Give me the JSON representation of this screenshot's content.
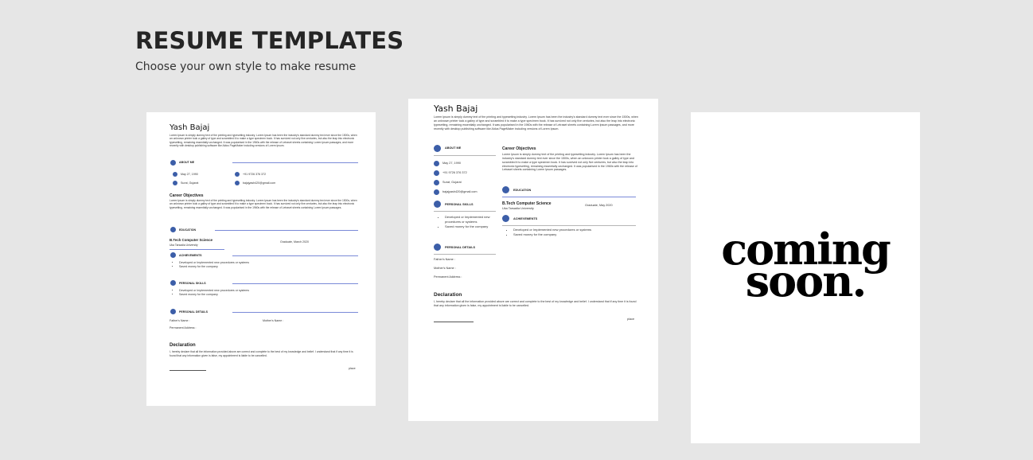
{
  "header": {
    "title": "RESUME TEMPLATES",
    "subtitle": "Choose your own style to make resume"
  },
  "resume": {
    "name": "Yash Bajaj",
    "summary": "Lorem Ipsum is simply dummy text of the printing and typesetting industry. Lorem Ipsum has been the industry's standard dummy text ever since the 1500s, when an unknown printer took a galley of type and scrambled it to make a type specimen book. It has survived not only five centuries, but also the leap into electronic typesetting, remaining essentially unchanged. It was popularised in the 1960s with the release of Letraset sheets containing Lorem Ipsum passages, and more recently with desktop publishing software like Aldus PageMaker including versions of Lorem Ipsum.",
    "about_heading": "ABOUT ME",
    "dob": "May 27, 1990",
    "phone": "+91 9726 376 372",
    "location": "Surat, Gujarat",
    "email": "bajajyash420@gmail.com",
    "objective_heading": "Career Objectives",
    "objective": "Lorem Ipsum is simply dummy text of the printing and typesetting industry. Lorem Ipsum has been the industry's standard dummy text ever since the 1500s, when an unknown printer took a galley of type and scrambled it to make a type specimen book. It has survived not only five centuries, but also the leap into electronic typesetting, remaining essentially unchanged. It was popularised in the 1960s with the release of Letraset sheets containing Lorem Ipsum passages.",
    "education_heading": "EDUCATION",
    "degree": "B.Tech Computer Science",
    "university": "Uka Tarsadia University",
    "graduation": "Graduate, March 2020",
    "graduation_alt": "Graduate, May 2020",
    "achievements_heading": "ACHIEVEMENTS",
    "achievements": [
      "Developed or Implemented new procedures or systems",
      "Saved money for the company"
    ],
    "skills_heading": "PERSONAL SKILLS",
    "details_heading": "PERSONAL DETAILS",
    "father": "Father's Name :",
    "mother": "Mother's Name :",
    "address": "Permanent Address :",
    "declaration_heading": "Declaration",
    "declaration": "I, hereby declare that all the information provided above are correct and complete to the best of my knowledge and belief. I understand that if any time it is found that any information given is false, my appointment is liable to be cancelled.",
    "place": "place"
  },
  "coming_soon": {
    "line1": "coming",
    "line2": "soon."
  }
}
